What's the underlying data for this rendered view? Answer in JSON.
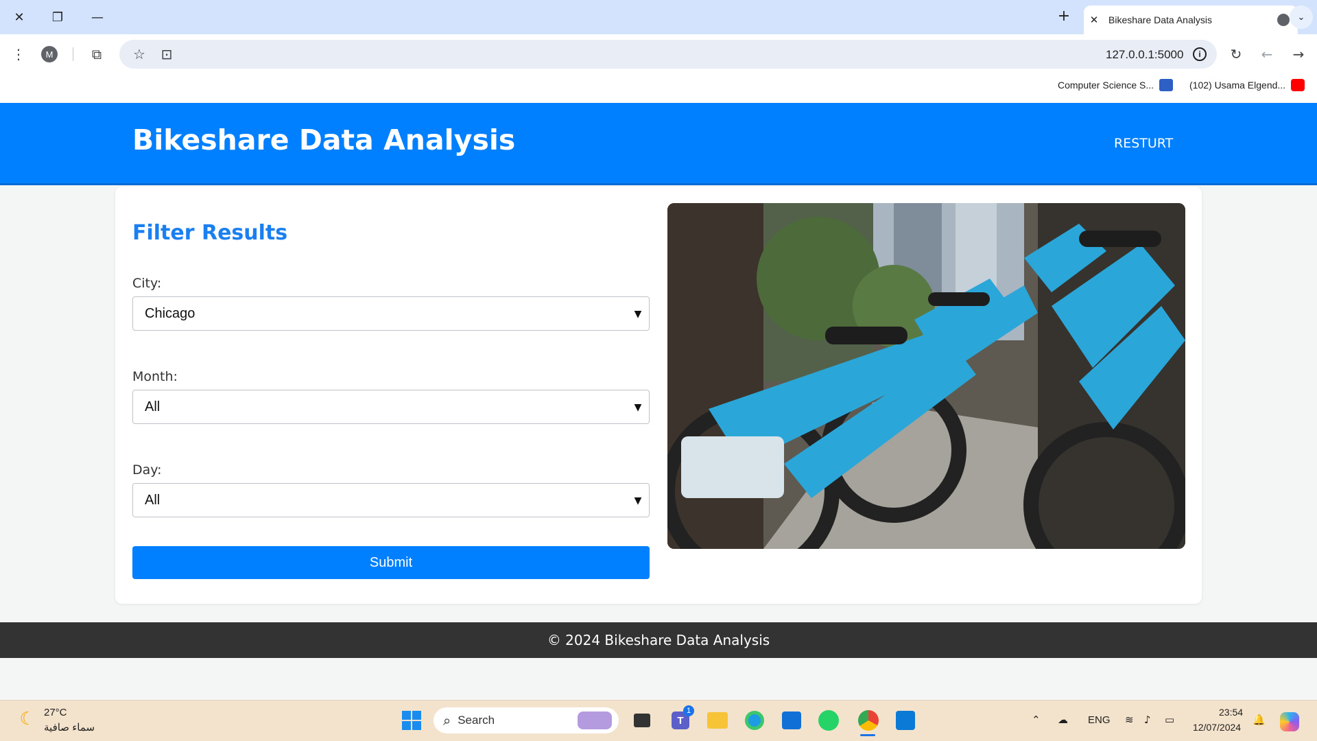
{
  "browser": {
    "tab_title": "Bikeshare Data Analysis",
    "url": "127.0.0.1:5000",
    "profile_initial": "M",
    "bookmarks": [
      {
        "label": "Computer Science S..."
      },
      {
        "label": "(102) Usama Elgend..."
      }
    ]
  },
  "site": {
    "title": "Bikeshare Data Analysis",
    "nav_link": "RESTURT",
    "filter_title": "Filter Results",
    "fields": {
      "city": {
        "label": "City:",
        "value": "Chicago"
      },
      "month": {
        "label": "Month:",
        "value": "All"
      },
      "day": {
        "label": "Day:",
        "value": "All"
      }
    },
    "submit_label": "Submit",
    "footer": "© 2024 Bikeshare Data Analysis"
  },
  "taskbar": {
    "weather_temp": "27°C",
    "weather_desc": "سماء صافية",
    "search_placeholder": "Search",
    "teams_badge": "1",
    "language": "ENG",
    "time": "23:54",
    "date": "12/07/2024"
  },
  "colors": {
    "header_blue": "#0080ff",
    "title_blue": "#1a7ff0",
    "footer_dark": "#333333"
  }
}
